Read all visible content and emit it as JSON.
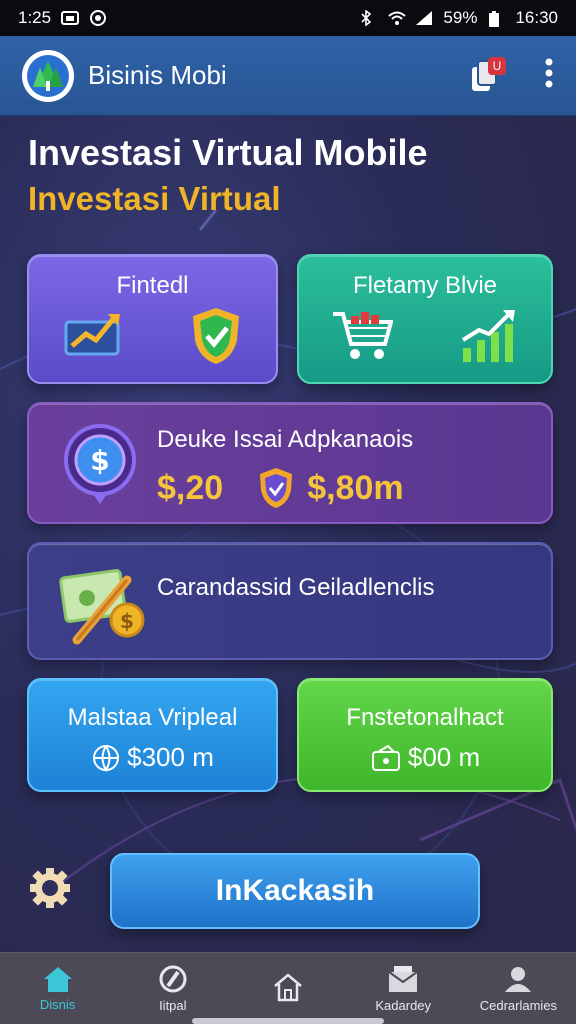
{
  "status_bar": {
    "time_left": "1:25",
    "battery": "59%",
    "time_right": "16:30"
  },
  "app_bar": {
    "title": "Bisinis Mobi",
    "badge": "U"
  },
  "header": {
    "title": "Investasi Virtual Mobile",
    "subtitle": "Investasi Virtual"
  },
  "cards": {
    "fintech_label": "Fintedl",
    "retail_label": "Fletamy Blvie",
    "deposit": {
      "label": "Deuke Issai Adpkanaois",
      "value_left": "$,20",
      "value_right": "$,80m"
    },
    "card_accounts_label": "Carandassid Geiladlenclis",
    "blue": {
      "label": "Malstaa Vripleal",
      "value": "$300 m"
    },
    "green": {
      "label": "Fnstetonalhact",
      "value": "$00 m"
    }
  },
  "cta_label": "InKackasih",
  "bottom_nav": [
    {
      "label": "Disnis"
    },
    {
      "label": "Iitpal"
    },
    {
      "label": ""
    },
    {
      "label": "Kadardey"
    },
    {
      "label": "Cedrarlamies"
    }
  ],
  "colors": {
    "accent_gold": "#f0b428",
    "nav_active": "#3cc6d8"
  }
}
